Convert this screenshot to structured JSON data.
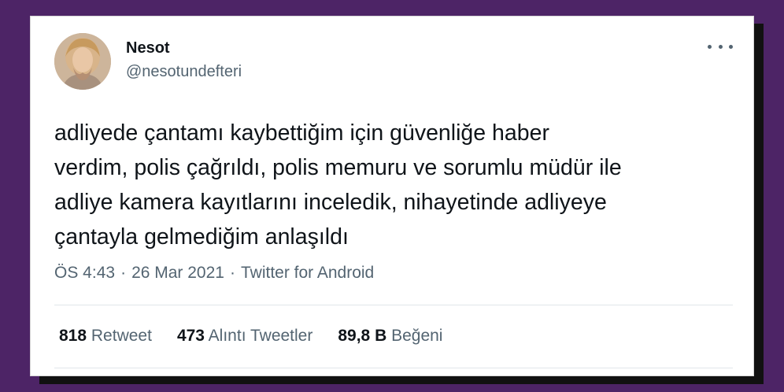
{
  "tweet": {
    "author": {
      "name": "Nesot",
      "handle": "@nesotundefteri"
    },
    "text": "adliyede çantamı kaybettiğim için güvenliğe haber\nverdim, polis çağrıldı, polis memuru ve sorumlu müdür ile\nadliye kamera kayıtlarını inceledik, nihayetinde adliyeye\nçantayla gelmediğim anlaşıldı",
    "time": "ÖS 4:43",
    "date": "26 Mar 2021",
    "source": "Twitter for Android",
    "separator": "·",
    "stats": {
      "retweets": {
        "count": "818",
        "label": "Retweet"
      },
      "quotes": {
        "count": "473",
        "label": "Alıntı Tweetler"
      },
      "likes": {
        "count": "89,8 B",
        "label": "Beğeni"
      }
    },
    "more_icon": "more-horizontal-icon"
  },
  "colors": {
    "page_background": "#4d2466",
    "text_primary": "#0f1419",
    "text_secondary": "#536471"
  }
}
